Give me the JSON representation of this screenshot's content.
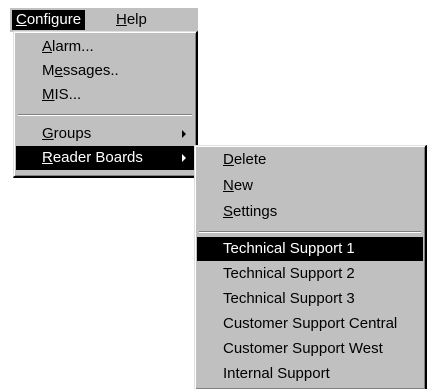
{
  "menubar": {
    "items": [
      {
        "label": "Configure",
        "mnemonic": "C",
        "rest": "onfigure",
        "selected": true
      },
      {
        "label": "Help",
        "mnemonic": "H",
        "rest": "elp",
        "selected": false
      }
    ]
  },
  "configure_menu": {
    "items": [
      {
        "label": "Alarm...",
        "pre": "",
        "mnemonic": "A",
        "rest": "larm..."
      },
      {
        "label": "Messages..",
        "pre": "M",
        "mnemonic": "e",
        "rest": "ssages.."
      },
      {
        "label": "MIS...",
        "pre": "",
        "mnemonic": "M",
        "rest": "IS..."
      },
      {
        "label": "Groups",
        "pre": "",
        "mnemonic": "G",
        "rest": "roups",
        "submenu": true
      },
      {
        "label": "Reader Boards",
        "pre": "",
        "mnemonic": "R",
        "rest": "eader Boards",
        "submenu": true,
        "highlighted": true
      }
    ]
  },
  "reader_boards_menu": {
    "items": [
      {
        "label": "Delete",
        "pre": "",
        "mnemonic": "D",
        "rest": "elete"
      },
      {
        "label": "New",
        "pre": "",
        "mnemonic": "N",
        "rest": "ew"
      },
      {
        "label": "Settings",
        "pre": "",
        "mnemonic": "S",
        "rest": "ettings"
      }
    ],
    "boards": [
      {
        "label": "Technical Support 1",
        "highlighted": true
      },
      {
        "label": "Technical Support 2"
      },
      {
        "label": "Technical Support 3"
      },
      {
        "label": "Customer Support Central"
      },
      {
        "label": "Customer Support West"
      },
      {
        "label": "Internal Support"
      }
    ]
  },
  "colors": {
    "menu_face": "#c0c0c0",
    "highlight": "#000000",
    "highlight_text": "#ffffff"
  }
}
